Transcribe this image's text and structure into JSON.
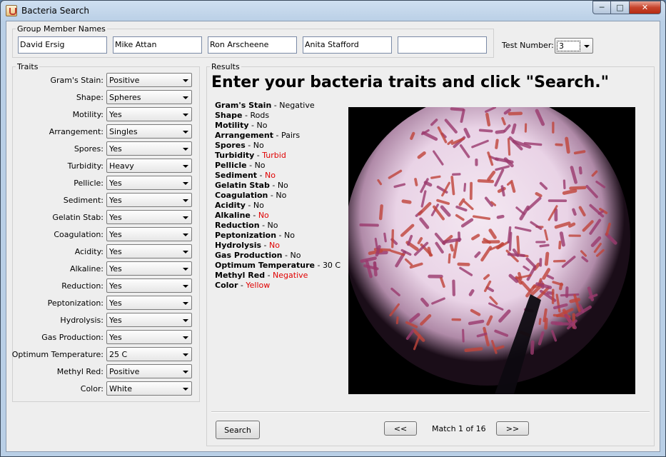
{
  "window": {
    "title": "Bacteria Search"
  },
  "group": {
    "legend": "Group Member Names",
    "members": [
      "David Ersig",
      "Mike Attan",
      "Ron Arscheene",
      "Anita Stafford",
      ""
    ]
  },
  "test": {
    "label": "Test Number:",
    "value": "3"
  },
  "traits": {
    "legend": "Traits",
    "items": [
      {
        "label": "Gram's Stain:",
        "value": "Positive"
      },
      {
        "label": "Shape:",
        "value": "Spheres"
      },
      {
        "label": "Motility:",
        "value": "Yes"
      },
      {
        "label": "Arrangement:",
        "value": "Singles"
      },
      {
        "label": "Spores:",
        "value": "Yes"
      },
      {
        "label": "Turbidity:",
        "value": "Heavy"
      },
      {
        "label": "Pellicle:",
        "value": "Yes"
      },
      {
        "label": "Sediment:",
        "value": "Yes"
      },
      {
        "label": "Gelatin Stab:",
        "value": "Yes"
      },
      {
        "label": "Coagulation:",
        "value": "Yes"
      },
      {
        "label": "Acidity:",
        "value": "Yes"
      },
      {
        "label": "Alkaline:",
        "value": "Yes"
      },
      {
        "label": "Reduction:",
        "value": "Yes"
      },
      {
        "label": "Peptonization:",
        "value": "Yes"
      },
      {
        "label": "Hydrolysis:",
        "value": "Yes"
      },
      {
        "label": "Gas Production:",
        "value": "Yes"
      },
      {
        "label": "Optimum Temperature:",
        "value": "25 C"
      },
      {
        "label": "Methyl Red:",
        "value": "Positive"
      },
      {
        "label": "Color:",
        "value": "White"
      }
    ]
  },
  "results": {
    "legend": "Results",
    "heading": "Enter your bacteria traits and click \"Search.\"",
    "separator": " - ",
    "lines": [
      {
        "name": "Gram's Stain",
        "value": "Negative",
        "mismatch": false
      },
      {
        "name": "Shape",
        "value": "Rods",
        "mismatch": false
      },
      {
        "name": "Motility",
        "value": "No",
        "mismatch": false
      },
      {
        "name": "Arrangement",
        "value": "Pairs",
        "mismatch": false
      },
      {
        "name": "Spores",
        "value": "No",
        "mismatch": false
      },
      {
        "name": "Turbidity",
        "value": "Turbid",
        "mismatch": true
      },
      {
        "name": "Pellicle",
        "value": "No",
        "mismatch": false
      },
      {
        "name": "Sediment",
        "value": "No",
        "mismatch": true
      },
      {
        "name": "Gelatin Stab",
        "value": "No",
        "mismatch": false
      },
      {
        "name": "Coagulation",
        "value": "No",
        "mismatch": false
      },
      {
        "name": "Acidity",
        "value": "No",
        "mismatch": false
      },
      {
        "name": "Alkaline",
        "value": "No",
        "mismatch": true
      },
      {
        "name": "Reduction",
        "value": "No",
        "mismatch": false
      },
      {
        "name": "Peptonization",
        "value": "No",
        "mismatch": false
      },
      {
        "name": "Hydrolysis",
        "value": "No",
        "mismatch": true
      },
      {
        "name": "Gas Production",
        "value": "No",
        "mismatch": false
      },
      {
        "name": "Optimum Temperature",
        "value": "30 C",
        "mismatch": false
      },
      {
        "name": "Methyl Red",
        "value": "Negative",
        "mismatch": true
      },
      {
        "name": "Color",
        "value": "Yellow",
        "mismatch": true
      }
    ],
    "search_label": "Search",
    "prev_label": "<<",
    "next_label": ">>",
    "match_text": "Match 1 of 16"
  },
  "colors": {
    "mismatch": "#e00000",
    "accent": "#b9cfe6"
  },
  "icons": {
    "app": "java-cup-icon",
    "minimize": "minimize-icon",
    "maximize": "maximize-icon",
    "close": "close-icon"
  }
}
